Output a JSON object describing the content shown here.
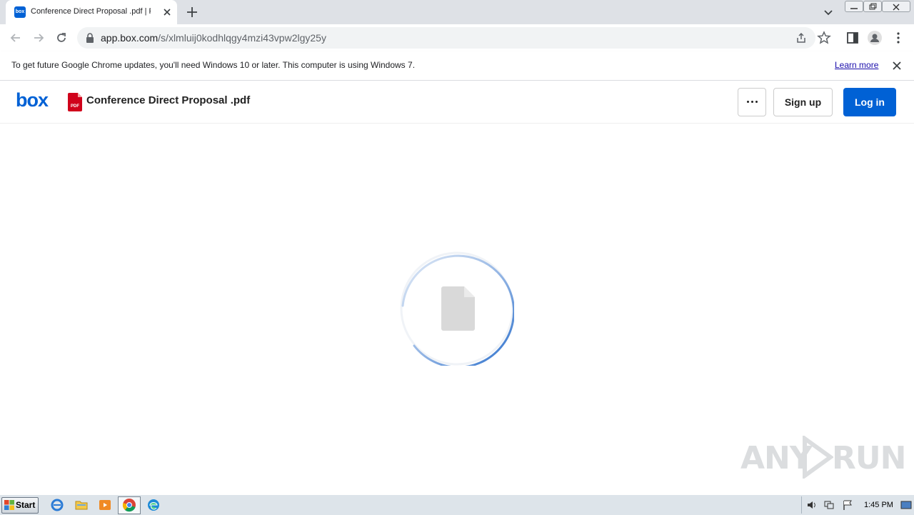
{
  "browser": {
    "tab_title": "Conference Direct Proposal .pdf | Po",
    "favicon_text": "box",
    "url_host": "app.box.com",
    "url_path": "/s/xlmluij0kodhlqgy4mzi43vpw2lgy25y"
  },
  "infobar": {
    "message": "To get future Google Chrome updates, you'll need Windows 10 or later. This computer is using Windows 7.",
    "link": "Learn more"
  },
  "box": {
    "logo": "box",
    "file_name": "Conference Direct Proposal .pdf",
    "pdf_badge": "PDF",
    "more_label": "More options",
    "signup_label": "Sign up",
    "login_label": "Log in",
    "brand_color": "#0061d5"
  },
  "loader": {
    "state": "loading"
  },
  "watermark": {
    "left": "ANY",
    "right": "RUN"
  },
  "taskbar": {
    "start_label": "Start",
    "clock": "1:45 PM"
  }
}
